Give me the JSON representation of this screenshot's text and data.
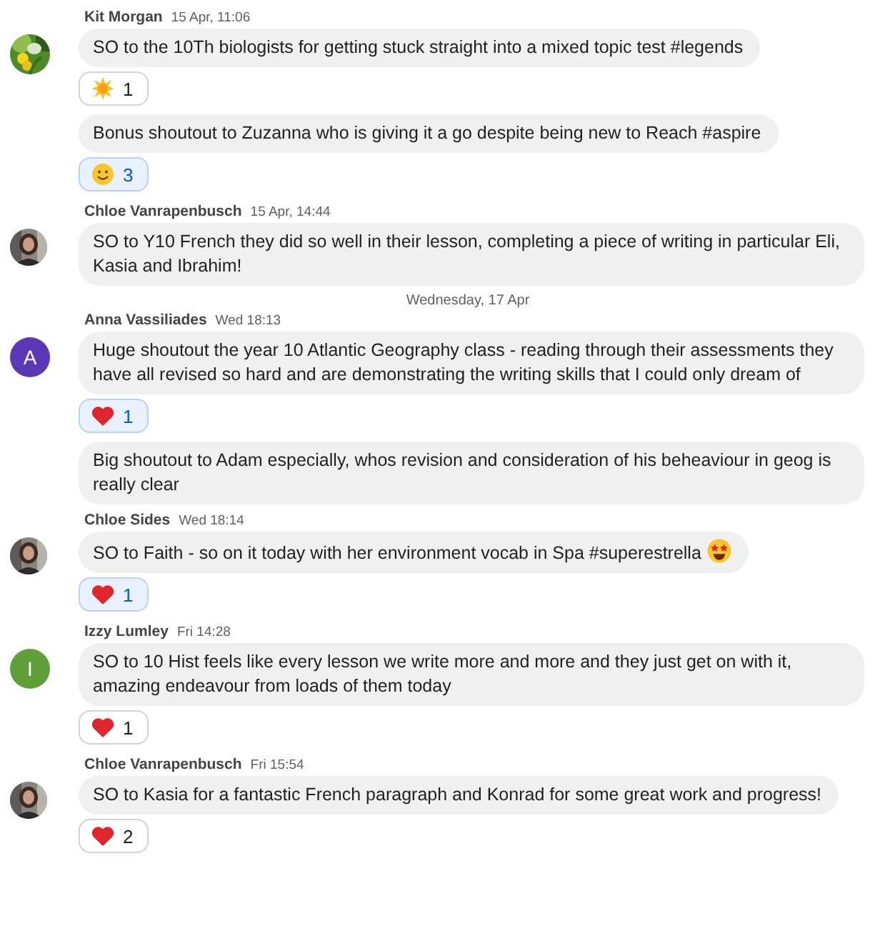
{
  "items": [
    {
      "kind": "group",
      "author": "Kit Morgan",
      "time": "15 Apr, 11:06",
      "avatar": {
        "kind": "picture"
      },
      "messages": [
        {
          "text": "SO to the 10Th biologists for getting stuck straight into a mixed topic test #legends",
          "reactions": [
            {
              "kind": "sparkle",
              "count": "1",
              "selected": false
            }
          ]
        },
        {
          "text": "Bonus shoutout to Zuzanna who is giving it a go despite being new to Reach #aspire",
          "reactions": [
            {
              "kind": "smile",
              "count": "3",
              "selected": true
            }
          ]
        }
      ]
    },
    {
      "kind": "group",
      "author": "Chloe Vanrapenbusch",
      "time": "15 Apr, 14:44",
      "avatar": {
        "kind": "picture"
      },
      "messages": [
        {
          "text": "SO to Y10 French they did so well in their lesson, completing a piece of writing in particular Eli, Kasia and Ibrahim!"
        }
      ]
    },
    {
      "kind": "date",
      "label": "Wednesday, 17 Apr"
    },
    {
      "kind": "group",
      "author": "Anna Vassiliades",
      "time": "Wed 18:13",
      "avatar": {
        "kind": "letter",
        "letter": "A",
        "color": "#5a38b5"
      },
      "messages": [
        {
          "text": "Huge shoutout the year 10 Atlantic Geography class - reading through their assessments they have all revised so hard and are demonstrating the writing skills that I could only dream of",
          "reactions": [
            {
              "kind": "heart",
              "count": "1",
              "selected": true
            }
          ]
        },
        {
          "text": "Big shoutout to Adam especially, whos revision and consideration of his beheaviour in geog is really clear"
        }
      ]
    },
    {
      "kind": "group",
      "author": "Chloe Sides",
      "time": "Wed 18:14",
      "avatar": {
        "kind": "picture"
      },
      "messages": [
        {
          "text": "SO to Faith - so on it today with her environment vocab in Spa #superestrella",
          "kind": "emoji-end",
          "reactions": [
            {
              "kind": "heart",
              "count": "1",
              "selected": true
            }
          ]
        }
      ]
    },
    {
      "kind": "group",
      "author": "Izzy Lumley",
      "time": "Fri 14:28",
      "avatar": {
        "kind": "letter",
        "letter": "I",
        "color": "#5f9f3a"
      },
      "messages": [
        {
          "text": "SO to 10 Hist feels like every lesson we write more and more and they just get on with it, amazing endeavour from loads of them today",
          "reactions": [
            {
              "kind": "heart",
              "count": "1",
              "selected": false
            }
          ]
        }
      ]
    },
    {
      "kind": "group",
      "author": "Chloe Vanrapenbusch",
      "time": "Fri 15:54",
      "avatar": {
        "kind": "picture"
      },
      "messages": [
        {
          "text": "SO to Kasia for a fantastic French paragraph and Konrad for some great work and progress!",
          "reactions": [
            {
              "kind": "heart",
              "count": "2",
              "selected": false
            }
          ]
        }
      ]
    }
  ]
}
